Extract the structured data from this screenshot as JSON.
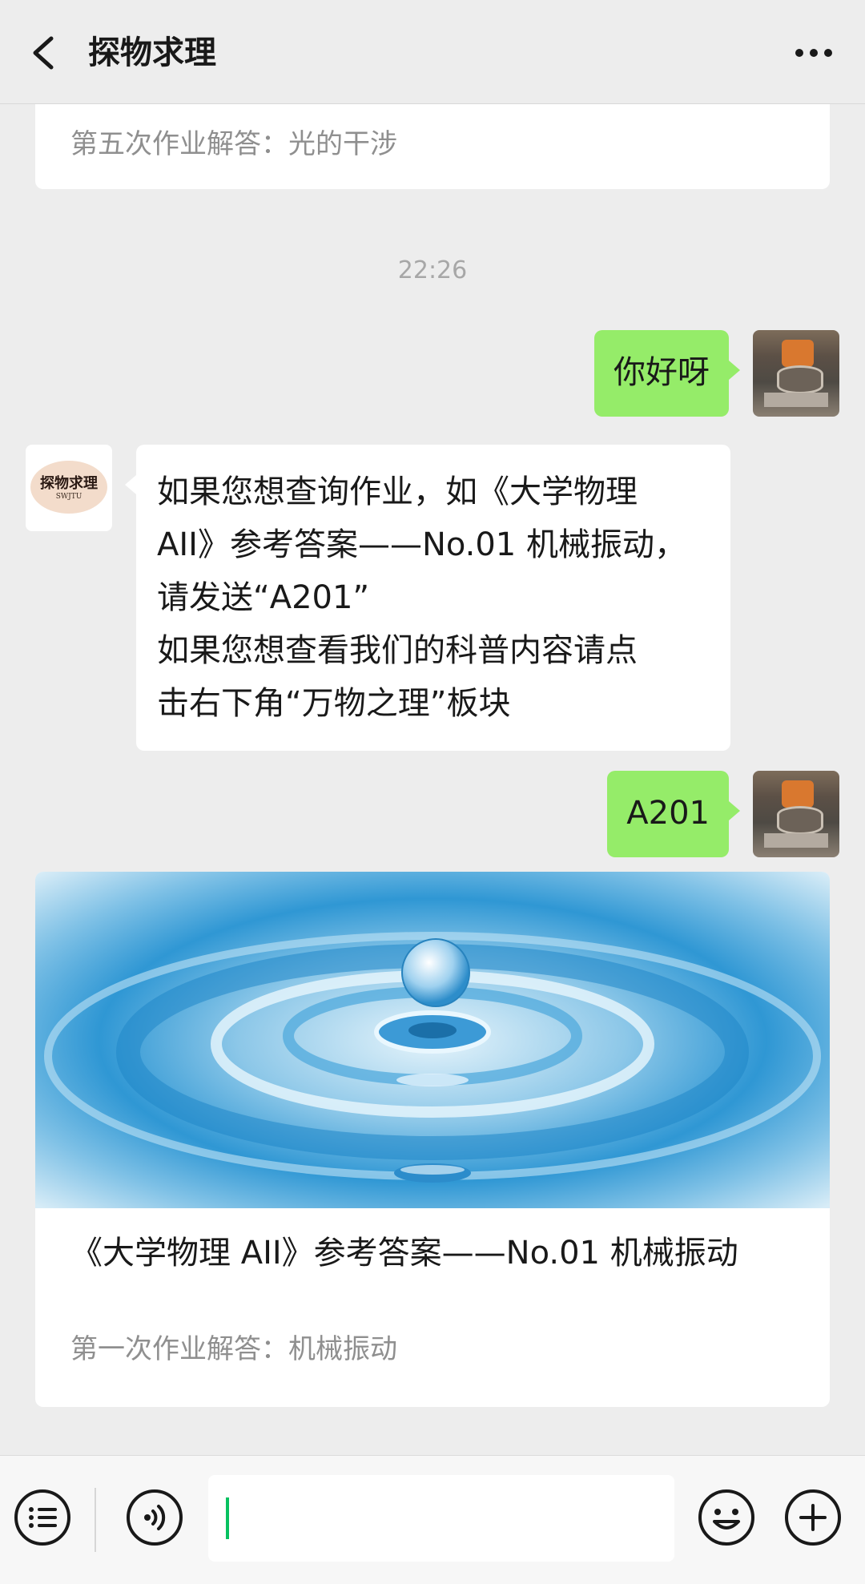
{
  "header": {
    "title": "探物求理"
  },
  "top_card": {
    "summary": "第五次作业解答：光的干涉"
  },
  "timestamp": "22:26",
  "messages": [
    {
      "from": "user",
      "text": "你好呀"
    },
    {
      "from": "bot",
      "lines": [
        "如果您想查询作业，如《大学物理",
        "AII》参考答案——No.01 机械振动，",
        "请发送“A201”",
        "如果您想查看我们的科普内容请点",
        "击右下角“万物之理”板块"
      ]
    },
    {
      "from": "user",
      "text": "A201"
    }
  ],
  "bot_avatar": {
    "logo_text": "探物求理",
    "logo_sub": "SWJTU"
  },
  "article": {
    "title": "《大学物理 AII》参考答案——No.01 机械振动",
    "summary": "第一次作业解答：机械振动"
  },
  "colors": {
    "outgoing_bubble": "#95ec69",
    "incoming_bubble": "#ffffff",
    "background": "#ededed",
    "cursor": "#07c160"
  },
  "icons": [
    "back-icon",
    "more-icon",
    "menu-icon",
    "voice-icon",
    "emoji-icon",
    "plus-icon"
  ]
}
